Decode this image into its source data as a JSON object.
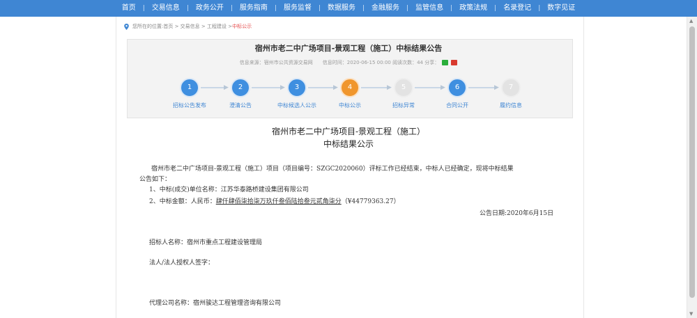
{
  "nav": {
    "items": [
      "首页",
      "交易信息",
      "政务公开",
      "服务指南",
      "服务监督",
      "数据服务",
      "金融服务",
      "监管信息",
      "政策法规",
      "名录登记",
      "数字见证"
    ]
  },
  "breadcrumb": {
    "prefix": "您所在的位置:",
    "path": "首页 > 交易信息 > 工程建设 > ",
    "current": "中标公示"
  },
  "article": {
    "title": "宿州市老二中广场项目-景观工程（施工）中标结果公告",
    "source": "信息来源：宿州市公共资源交易网",
    "time": "信息时间：2020-06-15 00:00 阅读次数：44 分享："
  },
  "steps": [
    {
      "num": "1",
      "label": "招标公告发布",
      "status": "done"
    },
    {
      "num": "2",
      "label": "澄清公告",
      "status": "done"
    },
    {
      "num": "3",
      "label": "中标候选人公示",
      "status": "done"
    },
    {
      "num": "4",
      "label": "中标公示",
      "status": "current"
    },
    {
      "num": "5",
      "label": "招标异常",
      "status": "inactive"
    },
    {
      "num": "6",
      "label": "合同公开",
      "status": "done"
    },
    {
      "num": "7",
      "label": "履约信息",
      "status": "inactive"
    }
  ],
  "doc": {
    "title1": "宿州市老二中广场项目-景观工程（施工）",
    "title2": "中标结果公示",
    "para1_line1": "宿州市老二中广场项目-景观工程（施工）项目（项目编号：SZGC2020060）评标工作已经结束，中标人已经确定，现将中标结果",
    "para1_line2": "公告如下：",
    "item1": "1、中标(成交)单位名称：江苏华泰路桥建设集团有限公司",
    "item2_prefix": "2、中标金额：人民币：",
    "item2_amount": "肆仟肆佰柒拾柒万玖仟叁佰陆拾叁元贰角柒分",
    "item2_suffix": "（¥44779363.27）",
    "date": "公告日期:2020年6月15日",
    "tenderer": "招标人名称：宿州市重点工程建设管理局",
    "legal": "法人/法人授权人签字：",
    "agency": "代理公司名称：宿州骏达工程管理咨询有限公司"
  },
  "colors": {
    "nav": "#3f86d3",
    "step_done": "#3f8fe0",
    "step_current": "#f0962d",
    "step_inactive": "#e3e3e3"
  }
}
